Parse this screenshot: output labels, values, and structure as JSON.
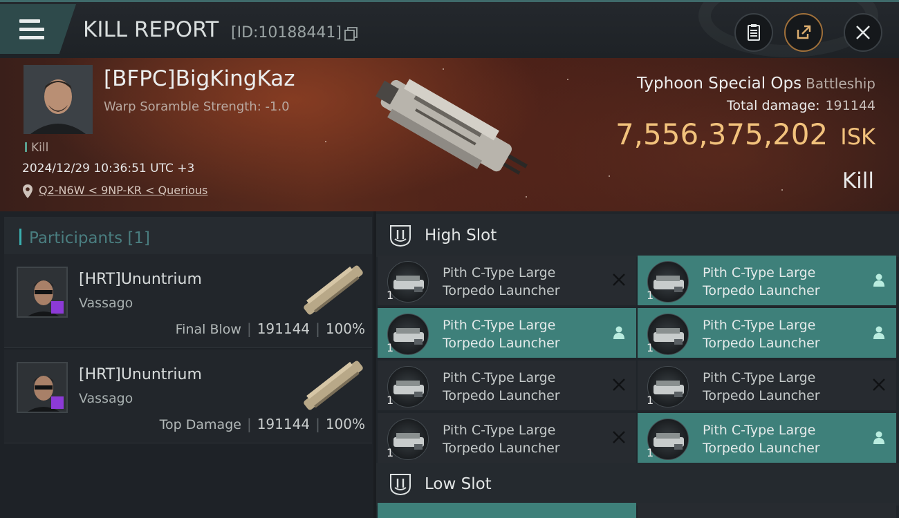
{
  "header": {
    "title": "KILL REPORT",
    "report_id": "[ID:10188441]"
  },
  "victim": {
    "name": "[BFPC]BigKingKaz",
    "subtitle": "Warp Soramble Strength: -1.0",
    "tag": "Kill",
    "datetime": "2024/12/29 10:36:51 UTC +3",
    "location": "Q2-N6W < 9NP-KR < Querious",
    "ship_name": "Typhoon Special Ops",
    "ship_class": "Battleship",
    "total_damage_label": "Total damage:",
    "total_damage": "191144",
    "isk_value": "7,556,375,202",
    "isk_unit": "ISK",
    "result": "Kill"
  },
  "participants": {
    "label": "Participants",
    "count": "[1]",
    "rows": [
      {
        "name": "[HRT]Ununtrium",
        "ship": "Vassago",
        "role": "Final Blow",
        "damage": "191144",
        "percent": "100%"
      },
      {
        "name": "[HRT]Ununtrium",
        "ship": "Vassago",
        "role": "Top Damage",
        "damage": "191144",
        "percent": "100%"
      }
    ]
  },
  "fitting": {
    "high_slot_label": "High Slot",
    "low_slot_label": "Low Slot",
    "high_slot": [
      {
        "name": "Pith C-Type Large Torpedo Launcher",
        "qty": "1",
        "status": "destroyed"
      },
      {
        "name": "Pith C-Type Large Torpedo Launcher",
        "qty": "1",
        "status": "dropped"
      },
      {
        "name": "Pith C-Type Large Torpedo Launcher",
        "qty": "1",
        "status": "dropped"
      },
      {
        "name": "Pith C-Type Large Torpedo Launcher",
        "qty": "1",
        "status": "dropped"
      },
      {
        "name": "Pith C-Type Large Torpedo Launcher",
        "qty": "1",
        "status": "destroyed"
      },
      {
        "name": "Pith C-Type Large Torpedo Launcher",
        "qty": "1",
        "status": "destroyed"
      },
      {
        "name": "Pith C-Type Large Torpedo Launcher",
        "qty": "1",
        "status": "destroyed"
      },
      {
        "name": "Pith C-Type Large Torpedo Launcher",
        "qty": "1",
        "status": "dropped"
      }
    ]
  },
  "colors": {
    "accent_teal": "#3e807a",
    "isk_gold": "#f2c27c",
    "hero_red": "#5a2a1c"
  },
  "icons": {
    "menu": "hamburger-menu-icon",
    "copy": "copy-icon",
    "clipboard": "clipboard-icon",
    "share": "share-icon",
    "close": "close-icon",
    "location": "location-pin-icon",
    "slot": "slot-icon",
    "destroyed": "x-icon",
    "dropped": "person-icon"
  }
}
